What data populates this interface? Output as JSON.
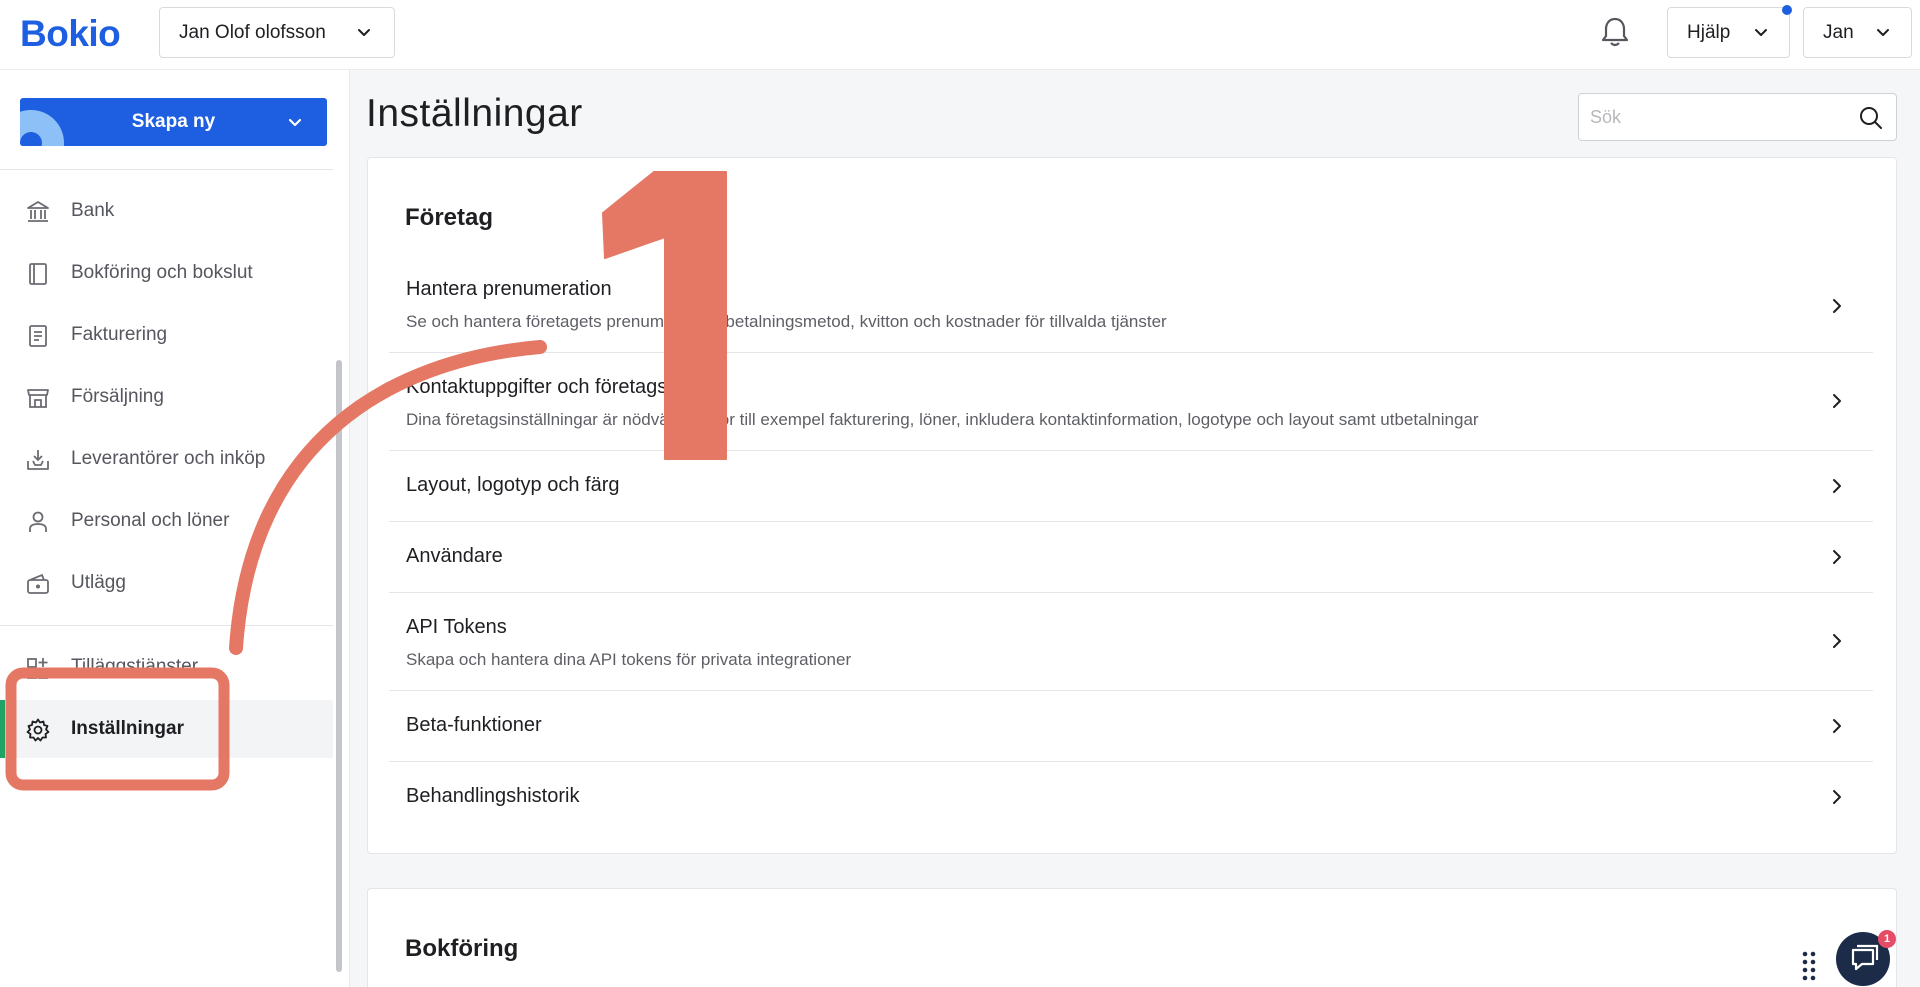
{
  "header": {
    "logo": "Bokio",
    "company": "Jan Olof olofsson",
    "help_label": "Hjälp",
    "user_label": "Jan",
    "accent_color": "#1d5fe0"
  },
  "sidebar": {
    "create_label": "Skapa ny",
    "items": [
      {
        "label": "Bank",
        "icon": "bank-icon"
      },
      {
        "label": "Bokföring och bokslut",
        "icon": "book-icon"
      },
      {
        "label": "Fakturering",
        "icon": "invoice-icon"
      },
      {
        "label": "Försäljning",
        "icon": "store-icon"
      },
      {
        "label": "Leverantörer och inköp",
        "icon": "inbox-download-icon"
      },
      {
        "label": "Personal och löner",
        "icon": "person-icon"
      },
      {
        "label": "Utlägg",
        "icon": "wallet-icon"
      },
      {
        "label": "Tilläggstjänster",
        "icon": "add-services-icon"
      },
      {
        "label": "Inställningar",
        "icon": "gear-icon",
        "active": true
      }
    ]
  },
  "main": {
    "title": "Inställningar",
    "search_placeholder": "Sök",
    "sections": [
      {
        "heading": "Företag",
        "rows": [
          {
            "title": "Hantera prenumeration",
            "desc": "Se och hantera företagets prenumeration, betalningsmetod, kvitton och kostnader för tillvalda tjänster"
          },
          {
            "title": "Kontaktuppgifter och företagsgrupp",
            "desc": "Dina företagsinställningar är nödvändiga för till exempel fakturering, löner, inkludera kontaktinformation, logotype och layout samt utbetalningar"
          },
          {
            "title": "Layout, logotyp och färg",
            "desc": ""
          },
          {
            "title": "Användare",
            "desc": ""
          },
          {
            "title": "API Tokens",
            "desc": "Skapa och hantera dina API tokens för privata integrationer"
          },
          {
            "title": "Beta-funktioner",
            "desc": ""
          },
          {
            "title": "Behandlingshistorik",
            "desc": ""
          }
        ]
      },
      {
        "heading": "Bokföring"
      }
    ]
  },
  "annotation": {
    "step_number": "1",
    "color": "#e57865"
  },
  "chat": {
    "badge_count": "1"
  }
}
